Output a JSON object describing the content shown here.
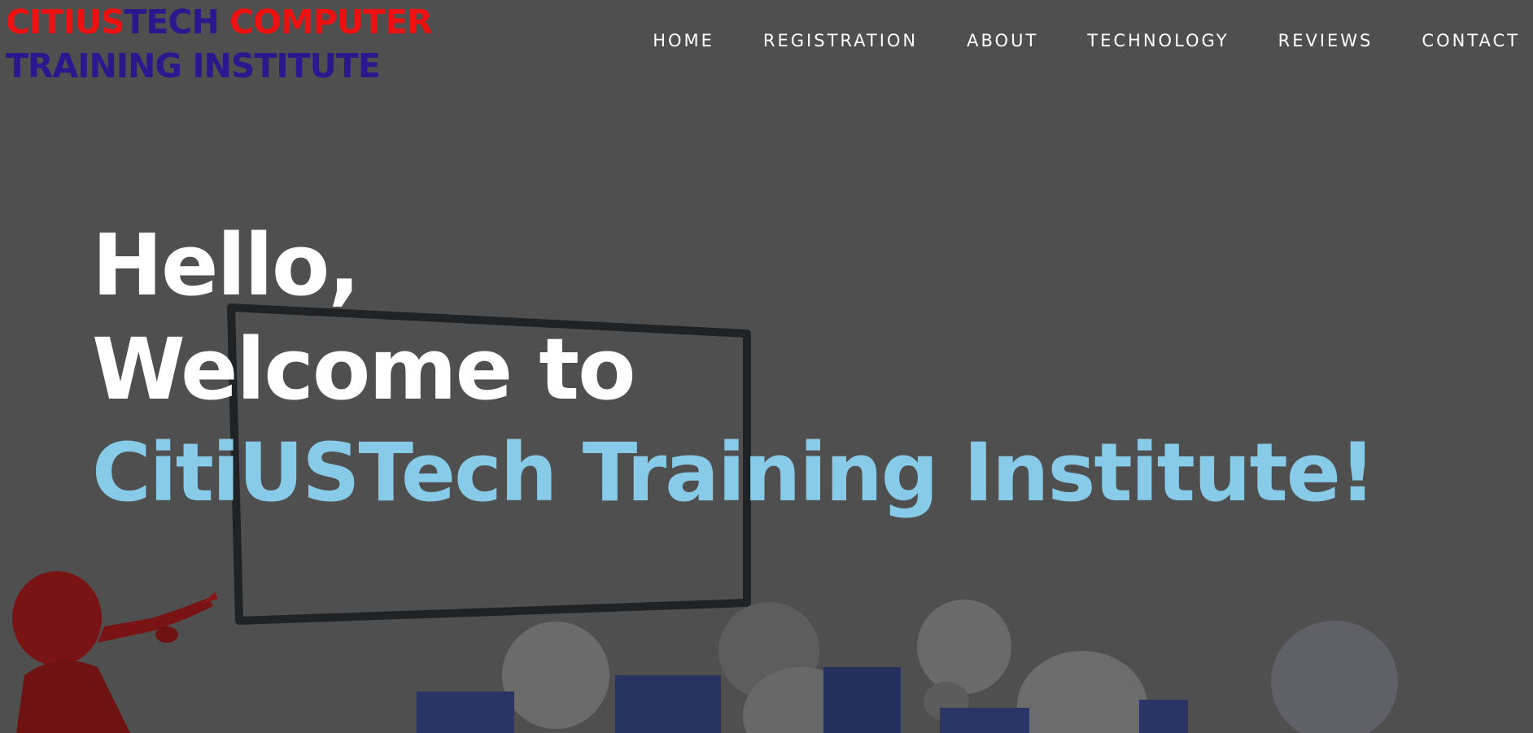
{
  "header": {
    "logo_line1_part1": "CITIUS",
    "logo_line1_part2": "TECH",
    "logo_line1_part3": " COMPUTER",
    "logo_line2": "TRAINING INSTITUTE"
  },
  "nav": {
    "items": [
      {
        "label": "HOME"
      },
      {
        "label": "REGISTRATION"
      },
      {
        "label": "ABOUT"
      },
      {
        "label": "TECHNOLOGY"
      },
      {
        "label": "REVIEWS"
      },
      {
        "label": "CONTACT"
      }
    ]
  },
  "hero": {
    "line1": "Hello,",
    "line2": "Welcome to",
    "line3": "CitiUSTech Training Institute!"
  },
  "colors": {
    "background": "#4f4f4f",
    "logo_red": "#ee1111",
    "logo_blue": "#2b188f",
    "accent": "#87cbe8",
    "nav_text": "#ffffff"
  }
}
